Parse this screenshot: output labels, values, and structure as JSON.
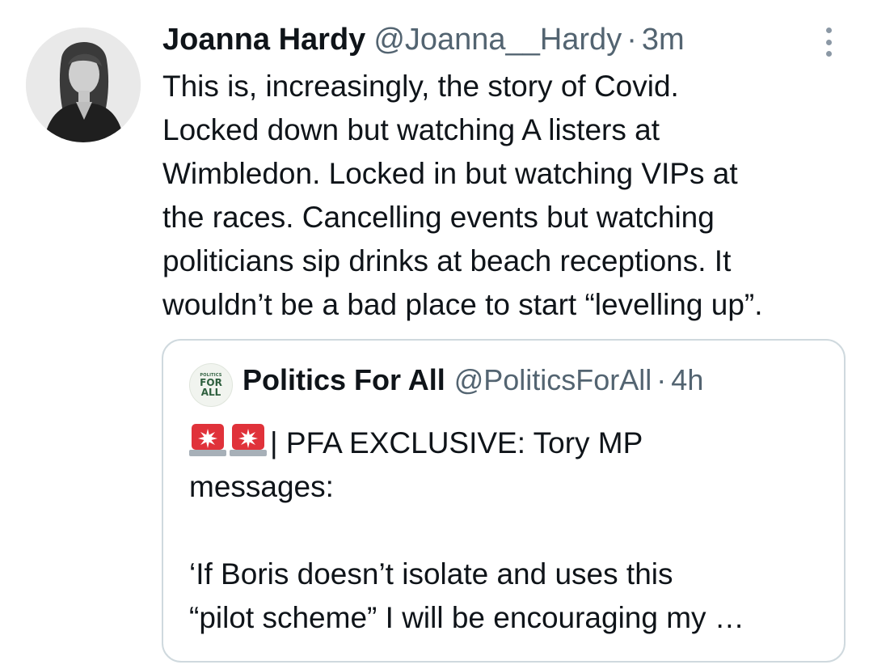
{
  "tweet": {
    "author_name": "Joanna Hardy",
    "author_handle": "@Joanna__Hardy",
    "separator": "·",
    "time": "3m",
    "avatar_icon": "profile-photo",
    "more_icon": "vertical-dots-icon",
    "lines": [
      "This is, increasingly, the story of Covid.",
      "Locked down but watching A listers at",
      "Wimbledon. Locked in but watching VIPs at",
      "the races. Cancelling events but watching",
      "politicians sip drinks at beach receptions. It",
      "wouldn’t be a bad place to start “levelling up”."
    ]
  },
  "quoted_tweet": {
    "author_name": "Politics For All",
    "author_handle": "@PoliticsForAll",
    "separator": "·",
    "time": "4h",
    "avatar_logo": {
      "line1": "POLITICS",
      "line2": "FOR",
      "line3": "ALL"
    },
    "emoji_icon": "police-light-icon",
    "line1_text": "| PFA EXCLUSIVE: Tory MP",
    "line2_text": "messages:",
    "line3_text": "‘If Boris doesn’t isolate and uses this",
    "line4_text": "“pilot scheme” I will be encouraging my …"
  },
  "colors": {
    "text_primary": "#0f1419",
    "text_secondary": "#536471",
    "border": "#cfd9de",
    "siren_red": "#e0323a"
  }
}
